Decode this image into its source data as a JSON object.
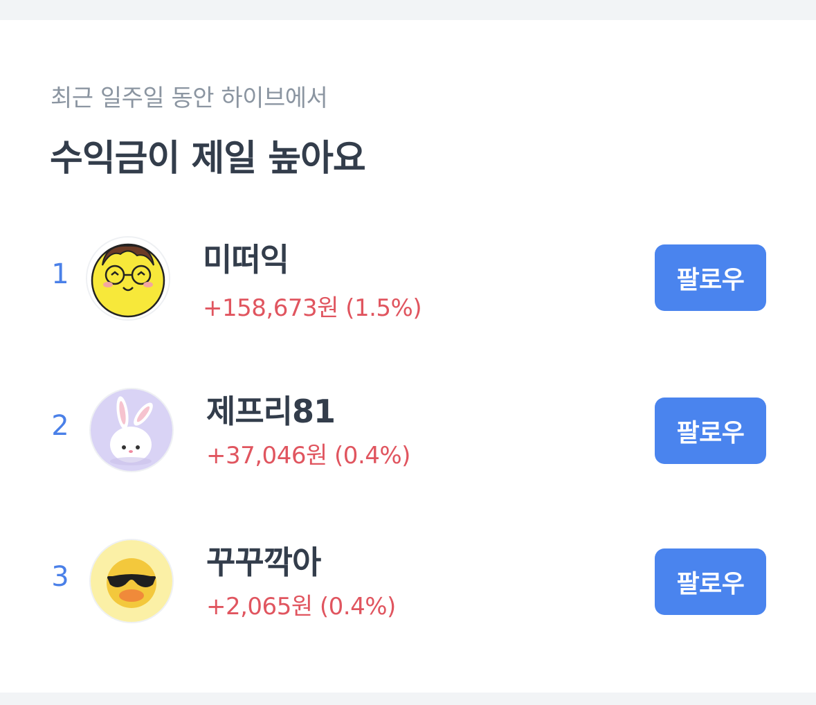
{
  "header": {
    "subtitle": "최근 일주일 동안 하이브에서",
    "title": "수익금이 제일 높아요"
  },
  "follow_label": "팔로우",
  "colors": {
    "rank": "#4a80e8",
    "profit": "#e0555f",
    "button": "#4a84ee",
    "title": "#333d4b",
    "subtitle": "#8b95a1"
  },
  "ranking": [
    {
      "rank": "1",
      "name": "미떠익",
      "profit": "+158,673원 (1.5%)",
      "avatar_icon": "glasses-face-icon"
    },
    {
      "rank": "2",
      "name": "제프리81",
      "profit": "+37,046원 (0.4%)",
      "avatar_icon": "bunny-icon"
    },
    {
      "rank": "3",
      "name": "꾸꾸깍아",
      "profit": "+2,065원 (0.4%)",
      "avatar_icon": "sunglasses-duck-icon"
    }
  ]
}
